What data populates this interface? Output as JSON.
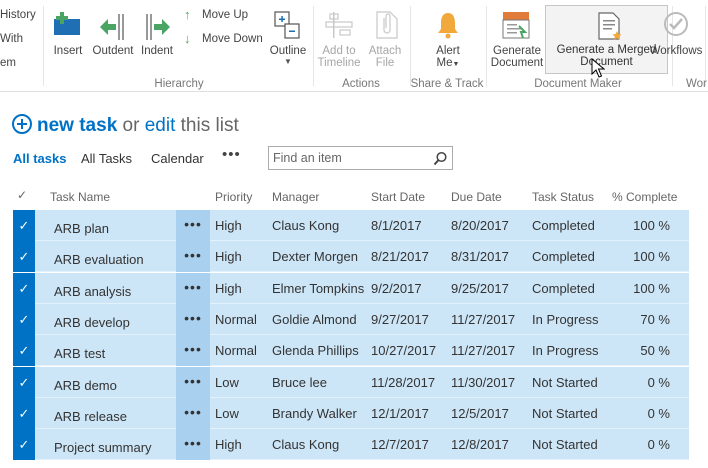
{
  "ribbon": {
    "left_items": [
      "History",
      "With",
      "em"
    ],
    "insert": "Insert",
    "outdent": "Outdent",
    "indent": "Indent",
    "move_up": "Move Up",
    "move_down": "Move Down",
    "outline": "Outline",
    "add_to_timeline_1": "Add to",
    "add_to_timeline_2": "Timeline",
    "attach_file_1": "Attach",
    "attach_file_2": "File",
    "alert_me_1": "Alert",
    "alert_me_2": "Me",
    "generate_document_1": "Generate",
    "generate_document_2": "Document",
    "generate_merged_1": "Generate a Merged",
    "generate_merged_2": "Document",
    "workflows": "Workflows",
    "wor": "Wor",
    "groups": {
      "hierarchy": "Hierarchy",
      "actions": "Actions",
      "share_track": "Share & Track",
      "document_maker": "Document Maker"
    }
  },
  "newtask": {
    "new": "new task",
    "or": "or",
    "edit": "edit",
    "rest": "this list"
  },
  "views": {
    "all_tasks_active": "All tasks",
    "all_tasks": "All Tasks",
    "calendar": "Calendar",
    "more": "•••"
  },
  "search": {
    "placeholder": "Find an item"
  },
  "table": {
    "headers": {
      "check": "✓",
      "task_name": "Task Name",
      "priority": "Priority",
      "manager": "Manager",
      "start_date": "Start Date",
      "due_date": "Due Date",
      "status": "Task Status",
      "complete": "% Complete"
    },
    "rows": [
      {
        "name": "ARB plan",
        "priority": "High",
        "manager": "Claus Kong",
        "start": "8/1/2017",
        "due": "8/20/2017",
        "status": "Completed",
        "pct": "100 %"
      },
      {
        "name": "ARB evaluation",
        "priority": "High",
        "manager": "Dexter Morgen",
        "start": "8/21/2017",
        "due": "8/31/2017",
        "status": "Completed",
        "pct": "100 %"
      },
      {
        "name": "ARB analysis",
        "priority": "High",
        "manager": "Elmer Tompkins",
        "start": "9/2/2017",
        "due": "9/25/2017",
        "status": "Completed",
        "pct": "100 %"
      },
      {
        "name": "ARB develop",
        "priority": "Normal",
        "manager": "Goldie Almond",
        "start": "9/27/2017",
        "due": "11/27/2017",
        "status": "In Progress",
        "pct": "70 %"
      },
      {
        "name": "ARB test",
        "priority": "Normal",
        "manager": "Glenda Phillips",
        "start": "10/27/2017",
        "due": "11/27/2017",
        "status": "In Progress",
        "pct": "50 %"
      },
      {
        "name": "ARB demo",
        "priority": "Low",
        "manager": "Bruce lee",
        "start": "11/28/2017",
        "due": "11/30/2017",
        "status": "Not Started",
        "pct": "0 %"
      },
      {
        "name": "ARB release",
        "priority": "Low",
        "manager": "Brandy Walker",
        "start": "12/1/2017",
        "due": "12/5/2017",
        "status": "Not Started",
        "pct": "0 %"
      },
      {
        "name": "Project summary",
        "priority": "High",
        "manager": "Claus Kong",
        "start": "12/7/2017",
        "due": "12/8/2017",
        "status": "Not Started",
        "pct": "0 %"
      }
    ]
  },
  "colors": {
    "accent": "#0072c6",
    "row_selected": "#cde6f7",
    "ellipsis_cell": "#a9d0ee",
    "green_arrow": "#4aa564",
    "bell": "#f2a93b"
  }
}
